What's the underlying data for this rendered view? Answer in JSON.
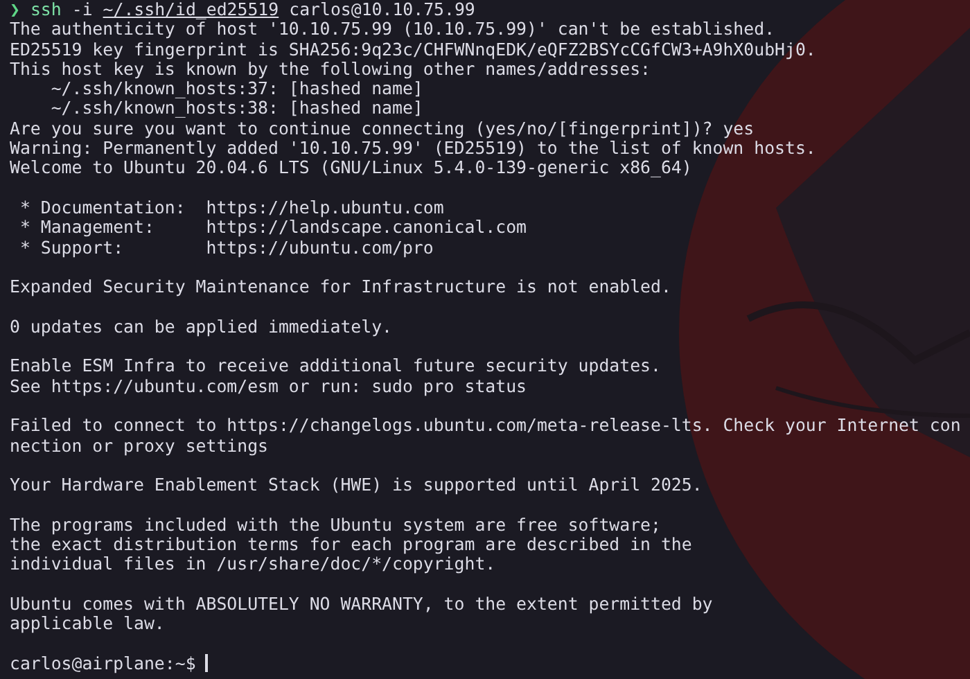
{
  "command": {
    "prompt_symbol": "❯",
    "program": "ssh",
    "flag": "-i",
    "key_path": "~/.ssh/id_ed25519",
    "target": "carlos@10.10.75.99"
  },
  "output_blocks": [
    {
      "lines": [
        "The authenticity of host '10.10.75.99 (10.10.75.99)' can't be established.",
        "ED25519 key fingerprint is SHA256:9q23c/CHFWNnqEDK/eQFZ2BSYcCGfCW3+A9hX0ubHj0.",
        "This host key is known by the following other names/addresses:",
        "    ~/.ssh/known_hosts:37: [hashed name]",
        "    ~/.ssh/known_hosts:38: [hashed name]",
        "Are you sure you want to continue connecting (yes/no/[fingerprint])? yes",
        "Warning: Permanently added '10.10.75.99' (ED25519) to the list of known hosts.",
        "Welcome to Ubuntu 20.04.6 LTS (GNU/Linux 5.4.0-139-generic x86_64)"
      ]
    },
    {
      "lines": [
        " * Documentation:  https://help.ubuntu.com",
        " * Management:     https://landscape.canonical.com",
        " * Support:        https://ubuntu.com/pro"
      ]
    },
    {
      "lines": [
        "Expanded Security Maintenance for Infrastructure is not enabled."
      ]
    },
    {
      "lines": [
        "0 updates can be applied immediately."
      ]
    },
    {
      "lines": [
        "Enable ESM Infra to receive additional future security updates.",
        "See https://ubuntu.com/esm or run: sudo pro status"
      ]
    },
    {
      "lines": [
        "Failed to connect to https://changelogs.ubuntu.com/meta-release-lts. Check your Internet con",
        "nection or proxy settings"
      ]
    },
    {
      "lines": [
        "Your Hardware Enablement Stack (HWE) is supported until April 2025."
      ]
    },
    {
      "lines": [
        "The programs included with the Ubuntu system are free software;",
        "the exact distribution terms for each program are described in the",
        "individual files in /usr/share/doc/*/copyright."
      ]
    },
    {
      "lines": [
        "Ubuntu comes with ABSOLUTELY NO WARRANTY, to the extent permitted by",
        "applicable law."
      ]
    }
  ],
  "prompt": {
    "text": "carlos@airplane:~$"
  }
}
